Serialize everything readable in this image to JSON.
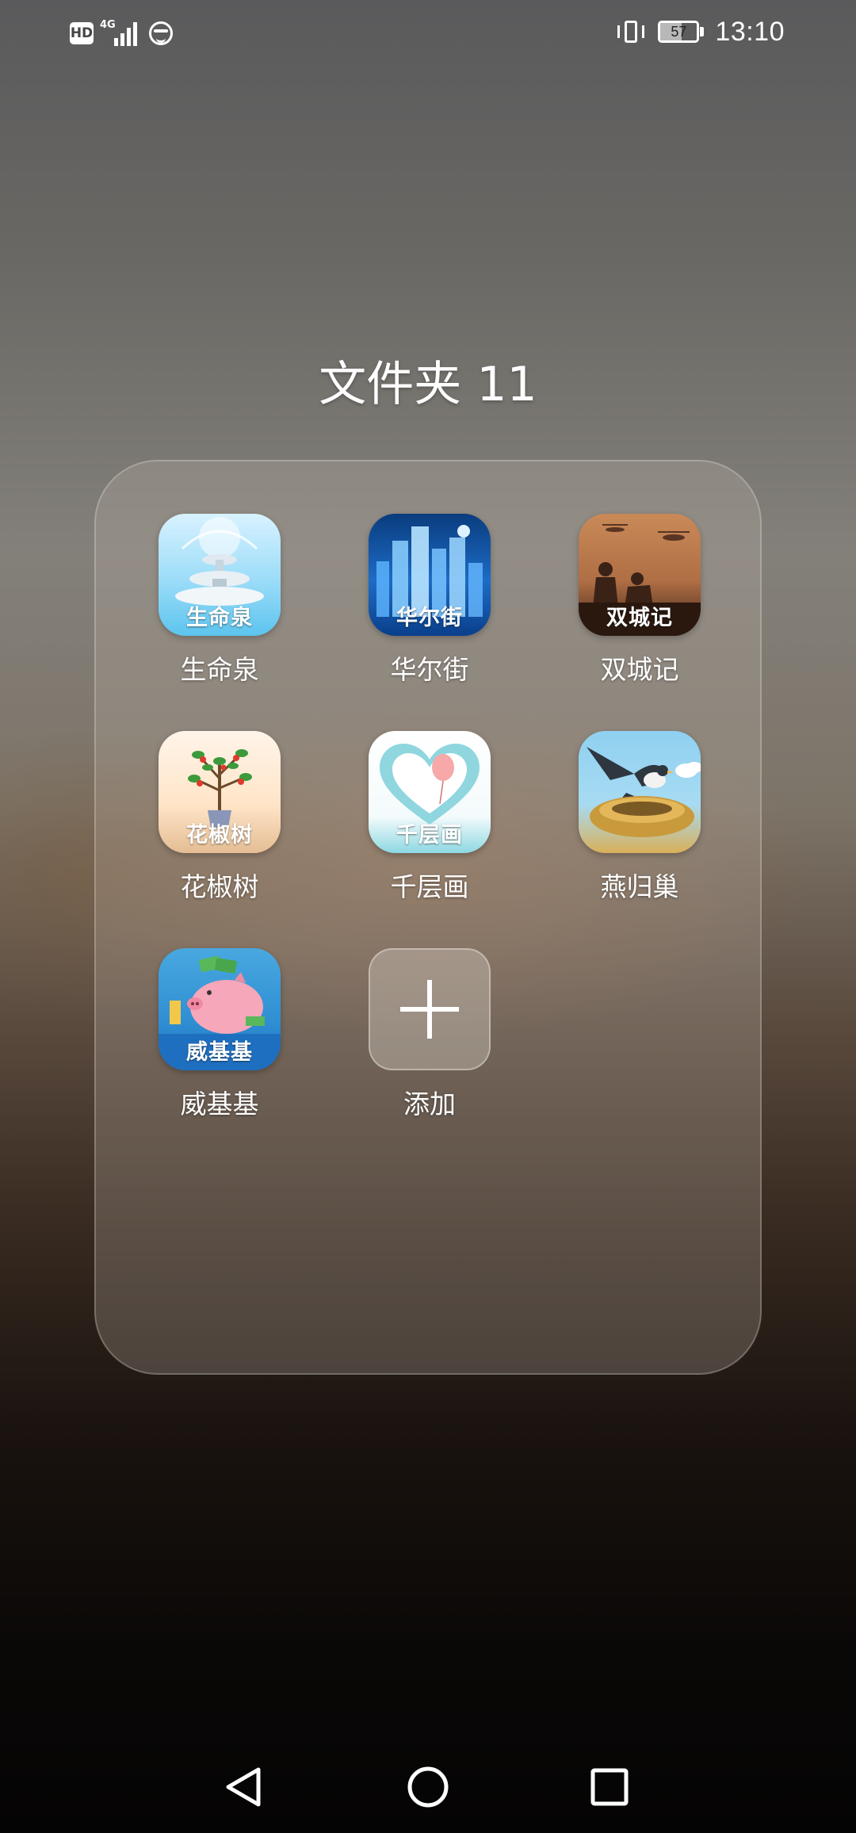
{
  "status_bar": {
    "hd_label": "HD",
    "network_label": "4G",
    "battery_percent": "57",
    "battery_level": 0.57,
    "time": "13:10",
    "icons": [
      "hd-icon",
      "signal-icon",
      "face-icon",
      "vibrate-icon",
      "battery-icon"
    ]
  },
  "folder": {
    "title": "文件夹 11",
    "apps": [
      {
        "label": "生命泉",
        "icon_caption": "生命泉",
        "icon": "fountain-icon"
      },
      {
        "label": "华尔街",
        "icon_caption": "华尔街",
        "icon": "city-skyline-icon"
      },
      {
        "label": "双城记",
        "icon_caption": "双城记",
        "icon": "soldiers-icon"
      },
      {
        "label": "花椒树",
        "icon_caption": "花椒树",
        "icon": "pepper-tree-icon"
      },
      {
        "label": "千层画",
        "icon_caption": "千层画",
        "icon": "heart-balloon-icon"
      },
      {
        "label": "燕归巢",
        "icon_caption": "",
        "icon": "swallow-nest-icon"
      },
      {
        "label": "威基基",
        "icon_caption": "威基基",
        "icon": "piggy-bank-icon"
      }
    ],
    "add_label": "添加"
  },
  "nav_bar": {
    "buttons": [
      "back-icon",
      "home-icon",
      "recents-icon"
    ]
  }
}
